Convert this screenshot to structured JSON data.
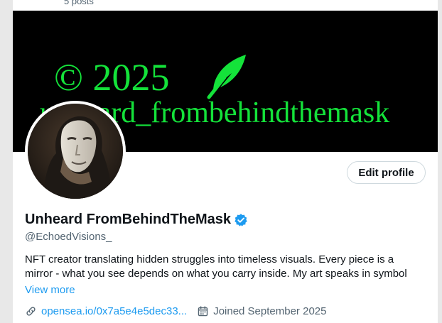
{
  "header": {
    "posts_count": "5 posts"
  },
  "banner": {
    "copyright_text": "© 2025",
    "handle_text": "unheard_frombehindthemask",
    "text_color": "#14e23a",
    "background": "#000000",
    "feather_icon": "feather-icon"
  },
  "profile": {
    "display_name": "Unheard FromBehindTheMask",
    "handle": "@EchoedVisions_",
    "verified_icon": "verified-badge-icon",
    "edit_button_label": "Edit profile",
    "bio": "NFT creator translating hidden struggles into timeless visuals. Every piece is a mirror - what you see depends on what you carry inside. My art speaks in symbol",
    "view_more_label": "View more",
    "link_icon": "link-icon",
    "link_text": "opensea.io/0x7a5e4e5dec33...",
    "calendar_icon": "calendar-icon",
    "joined_text": "Joined September 2025"
  },
  "colors": {
    "accent": "#1d9bf0",
    "text_primary": "#0f1419",
    "text_secondary": "#536471"
  }
}
